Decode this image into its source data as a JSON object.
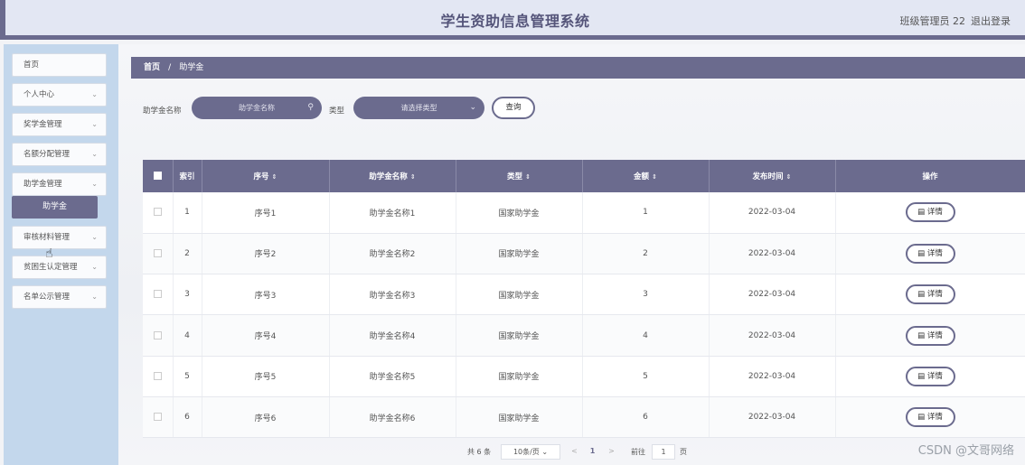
{
  "header": {
    "title": "学生资助信息管理系统",
    "user": "班级管理员 22",
    "logout": "退出登录"
  },
  "sidebar": {
    "items": [
      {
        "label": "首页",
        "chevron": ""
      },
      {
        "label": "个人中心",
        "chevron": "⌄"
      },
      {
        "label": "奖学金管理",
        "chevron": "⌄"
      },
      {
        "label": "名额分配管理",
        "chevron": "⌄"
      },
      {
        "label": "助学金管理",
        "chevron": "⌄"
      },
      {
        "label": "审核材料管理",
        "chevron": "⌄"
      },
      {
        "label": "贫困生认定管理",
        "chevron": "⌄"
      },
      {
        "label": "名单公示管理",
        "chevron": "⌄"
      }
    ],
    "submenu": {
      "label": "助学金"
    }
  },
  "breadcrumb": {
    "home": "首页",
    "separator": "/",
    "current": "助学金"
  },
  "search": {
    "name_label": "助学金名称",
    "name_placeholder": "助学金名称",
    "type_label": "类型",
    "type_placeholder": "请选择类型",
    "query_button": "查询"
  },
  "table": {
    "headers": {
      "index": "索引",
      "serial": "序号",
      "name": "助学金名称",
      "type": "类型",
      "amount": "金额",
      "date": "发布时间",
      "action": "操作"
    },
    "sort_icon": "⇕",
    "rows": [
      {
        "index": "1",
        "serial": "序号1",
        "name": "助学金名称1",
        "type": "国家助学金",
        "amount": "1",
        "date": "2022-03-04",
        "action": "详情"
      },
      {
        "index": "2",
        "serial": "序号2",
        "name": "助学金名称2",
        "type": "国家助学金",
        "amount": "2",
        "date": "2022-03-04",
        "action": "详情"
      },
      {
        "index": "3",
        "serial": "序号3",
        "name": "助学金名称3",
        "type": "国家助学金",
        "amount": "3",
        "date": "2022-03-04",
        "action": "详情"
      },
      {
        "index": "4",
        "serial": "序号4",
        "name": "助学金名称4",
        "type": "国家助学金",
        "amount": "4",
        "date": "2022-03-04",
        "action": "详情"
      },
      {
        "index": "5",
        "serial": "序号5",
        "name": "助学金名称5",
        "type": "国家助学金",
        "amount": "5",
        "date": "2022-03-04",
        "action": "详情"
      },
      {
        "index": "6",
        "serial": "序号6",
        "name": "助学金名称6",
        "type": "国家助学金",
        "amount": "6",
        "date": "2022-03-04",
        "action": "详情"
      }
    ]
  },
  "pagination": {
    "total": "共 6 条",
    "page_size": "10条/页",
    "prev": "<",
    "current_page": "1",
    "next": ">",
    "goto_label": "前往",
    "goto_value": "1",
    "page_suffix": "页"
  },
  "watermark": "CSDN @文哥网络",
  "colors": {
    "accent": "#6b6b8e",
    "sidebar_bg": "#c3d7ec",
    "header_bg": "#e3e7f3"
  }
}
